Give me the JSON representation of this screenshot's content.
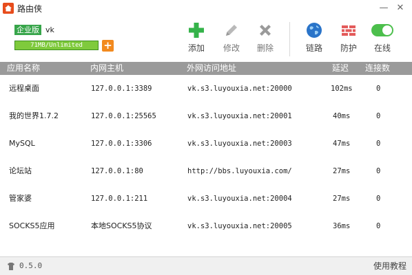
{
  "app": {
    "title": "路由侠"
  },
  "window": {
    "minimize": "—",
    "close": "✕"
  },
  "account": {
    "edition": "企业版",
    "username": "vk",
    "quota": "71MB/Unlimited",
    "quota_add": "+"
  },
  "toolbar": {
    "add": "添加",
    "edit": "修改",
    "delete": "删除",
    "link": "链路",
    "firewall": "防护",
    "online": "在线"
  },
  "colors": {
    "accent_green": "#37a54a",
    "add_icon": "#35b34a",
    "quota_bar": "#7fca3c",
    "header_bg": "#9a9a9a",
    "toggle_on": "#4cbf4c"
  },
  "table": {
    "headers": [
      "应用名称",
      "内网主机",
      "外网访问地址",
      "延迟",
      "连接数"
    ],
    "rows": [
      {
        "name": "远程桌面",
        "host": "127.0.0.1:3389",
        "external": "vk.s3.luyouxia.net:20000",
        "latency": "102ms",
        "connections": "0"
      },
      {
        "name": "我的世界1.7.2",
        "host": "127.0.0.1:25565",
        "external": "vk.s3.luyouxia.net:20001",
        "latency": "40ms",
        "connections": "0"
      },
      {
        "name": "MySQL",
        "host": "127.0.0.1:3306",
        "external": "vk.s3.luyouxia.net:20003",
        "latency": "47ms",
        "connections": "0"
      },
      {
        "name": "论坛站",
        "host": "127.0.0.1:80",
        "external": "http://bbs.luyouxia.com/",
        "latency": "27ms",
        "connections": "0"
      },
      {
        "name": "管家婆",
        "host": "127.0.0.1:211",
        "external": "vk.s3.luyouxia.net:20004",
        "latency": "27ms",
        "connections": "0"
      },
      {
        "name": "SOCKS5应用",
        "host": "本地SOCKS5协议",
        "external": "vk.s3.luyouxia.net:20005",
        "latency": "36ms",
        "connections": "0"
      }
    ]
  },
  "status": {
    "version": "0.5.0",
    "tutorial": "使用教程"
  }
}
